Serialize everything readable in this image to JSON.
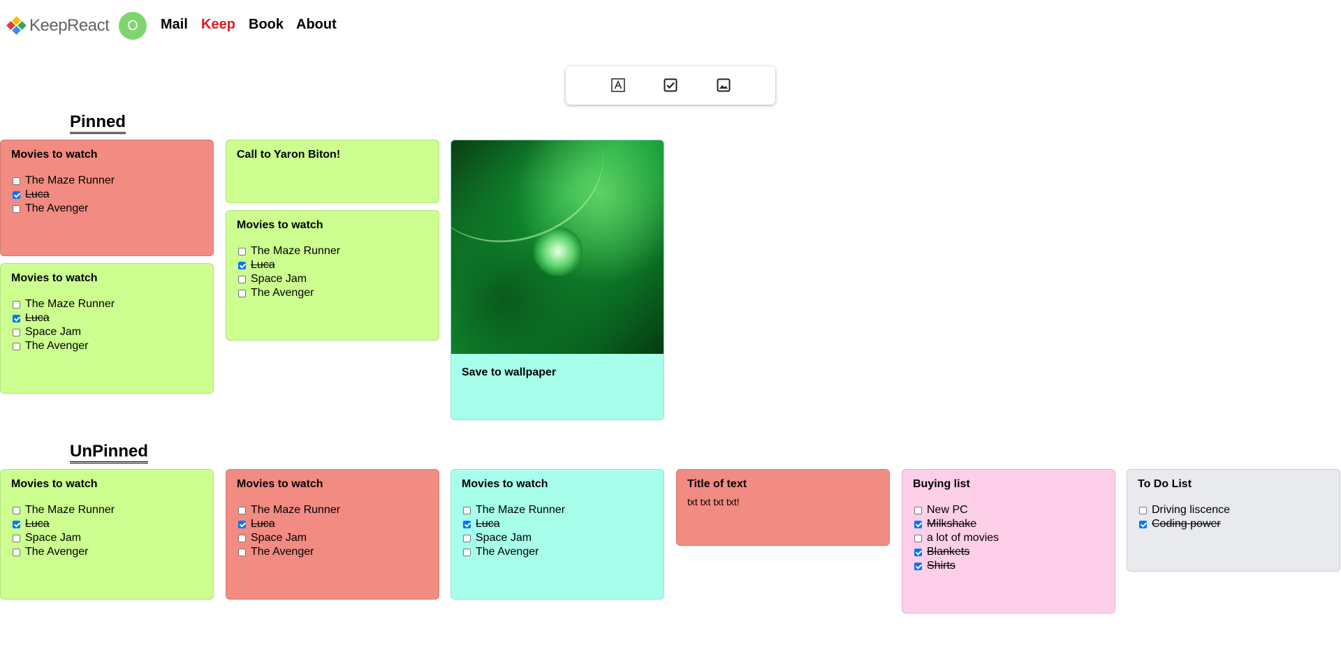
{
  "header": {
    "logo_text": "KeepReact",
    "avatar_letter": "O",
    "nav": {
      "mail": "Mail",
      "keep": "Keep",
      "book": "Book",
      "about": "About"
    },
    "active_nav": "Keep",
    "active_color": "#e01b1b"
  },
  "composer": {
    "buttons": [
      "text-note-icon",
      "todo-note-icon",
      "image-note-icon"
    ]
  },
  "sections": {
    "pinned": "Pinned",
    "unpinned": "UnPinned"
  },
  "pinned": {
    "n1": {
      "title": "Movies to watch",
      "color": "#f28b82",
      "items": [
        {
          "text": "The Maze Runner",
          "done": false
        },
        {
          "text": "Luca",
          "done": true
        },
        {
          "text": "The Avenger",
          "done": false
        }
      ]
    },
    "n2": {
      "title": "Movies to watch",
      "color": "#ccff90",
      "items": [
        {
          "text": "The Maze Runner",
          "done": false
        },
        {
          "text": "Luca",
          "done": true
        },
        {
          "text": "Space Jam",
          "done": false
        },
        {
          "text": "The Avenger",
          "done": false
        }
      ]
    },
    "n3": {
      "title": "Call to Yaron Biton!",
      "color": "#ccff90"
    },
    "n4": {
      "title": "Movies to watch",
      "color": "#ccff90",
      "items": [
        {
          "text": "The Maze Runner",
          "done": false
        },
        {
          "text": "Luca",
          "done": true
        },
        {
          "text": "Space Jam",
          "done": false
        },
        {
          "text": "The Avenger",
          "done": false
        }
      ]
    },
    "n5": {
      "title": "Save to wallpaper",
      "color": "#a7ffeb",
      "image": "green-leaf-water-drop-photo"
    }
  },
  "unpinned": {
    "u1": {
      "title": "Movies to watch",
      "color": "#ccff90",
      "items": [
        {
          "text": "The Maze Runner",
          "done": false
        },
        {
          "text": "Luca",
          "done": true
        },
        {
          "text": "Space Jam",
          "done": false
        },
        {
          "text": "The Avenger",
          "done": false
        }
      ]
    },
    "u2": {
      "title": "Movies to watch",
      "color": "#f28b82",
      "items": [
        {
          "text": "The Maze Runner",
          "done": false
        },
        {
          "text": "Luca",
          "done": true
        },
        {
          "text": "Space Jam",
          "done": false
        },
        {
          "text": "The Avenger",
          "done": false
        }
      ]
    },
    "u3": {
      "title": "Movies to watch",
      "color": "#a7ffeb",
      "items": [
        {
          "text": "The Maze Runner",
          "done": false
        },
        {
          "text": "Luca",
          "done": true
        },
        {
          "text": "Space Jam",
          "done": false
        },
        {
          "text": "The Avenger",
          "done": false
        }
      ]
    },
    "u4": {
      "title": "Title of text",
      "text": "txt txt txt txt!",
      "color": "#f28b82"
    },
    "u5": {
      "title": "Buying list",
      "color": "#fdcfe8",
      "items": [
        {
          "text": "New PC",
          "done": false
        },
        {
          "text": "Milkshake",
          "done": true
        },
        {
          "text": "a lot of movies",
          "done": false
        },
        {
          "text": "Blankets",
          "done": true
        },
        {
          "text": "Shirts",
          "done": true
        }
      ]
    },
    "u6": {
      "title": "To Do List",
      "color": "#e8eaed",
      "items": [
        {
          "text": "Driving liscence",
          "done": false
        },
        {
          "text": "Coding power",
          "done": true
        }
      ]
    }
  }
}
